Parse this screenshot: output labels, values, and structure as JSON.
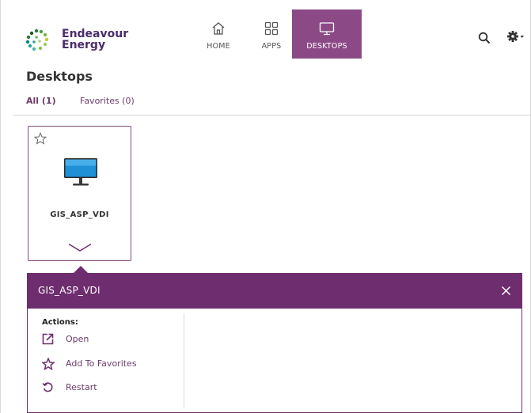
{
  "brand": {
    "line1": "Endeavour",
    "line2": "Energy"
  },
  "nav": {
    "home": "HOME",
    "apps": "APPS",
    "desktops": "DESKTOPS"
  },
  "icons": [
    "search-icon",
    "gear-icon",
    "home-icon",
    "apps-grid-icon",
    "desktop-icon",
    "star-icon",
    "monitor-icon",
    "chevron-down-icon",
    "close-icon",
    "open-external-icon",
    "restart-icon"
  ],
  "colors": {
    "accent": "#6e2d6f",
    "nav_active": "#8b4a86",
    "link": "#6b3b6a"
  },
  "page": {
    "title": "Desktops",
    "tabs": {
      "all": "All (1)",
      "favorites": "Favorites (0)"
    }
  },
  "tile": {
    "name": "GIS_ASP_VDI"
  },
  "details": {
    "title": "GIS_ASP_VDI",
    "actions_label": "Actions:",
    "actions": {
      "open": "Open",
      "add_favorites": "Add To Favorites",
      "restart": "Restart"
    }
  }
}
